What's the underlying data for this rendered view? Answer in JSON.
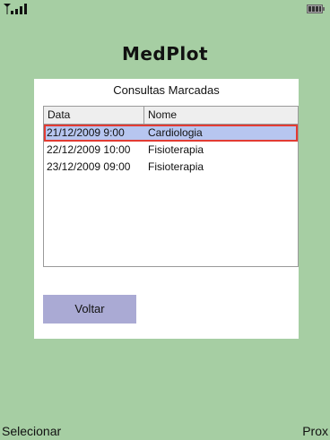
{
  "app": {
    "title": "MedPlot"
  },
  "panel": {
    "title": "Consultas Marcadas",
    "columns": [
      "Data",
      "Nome"
    ],
    "rows": [
      {
        "data": "21/12/2009 9:00",
        "nome": "Cardiologia",
        "selected": true
      },
      {
        "data": "22/12/2009 10:00",
        "nome": "Fisioterapia",
        "selected": false
      },
      {
        "data": "23/12/2009 09:00",
        "nome": "Fisioterapia",
        "selected": false
      }
    ],
    "back_label": "Voltar"
  },
  "softkeys": {
    "left": "Selecionar",
    "right": "Prox"
  },
  "colors": {
    "background": "#a6cea3",
    "selection": "#b7c6f0",
    "selection_border": "#e23b33",
    "button": "#aaaad4"
  },
  "icons": {
    "signal": "signal-strength-icon",
    "battery": "battery-icon"
  }
}
